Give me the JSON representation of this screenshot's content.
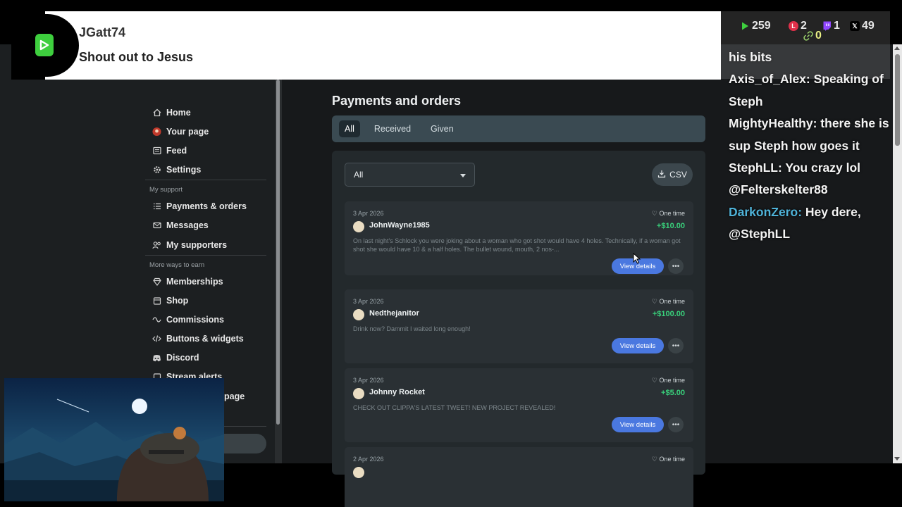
{
  "notification": {
    "username": "JGatt74",
    "message": "Shout out to Jesus"
  },
  "stats": {
    "rumble": "259",
    "lbry": "2",
    "twitch": "1",
    "x": "49",
    "links": "0"
  },
  "sidebar": {
    "items": [
      {
        "label": "Home",
        "icon": "home-icon"
      },
      {
        "label": "Your page",
        "icon": "avatar-icon"
      },
      {
        "label": "Feed",
        "icon": "feed-icon"
      },
      {
        "label": "Settings",
        "icon": "gear-icon"
      }
    ],
    "section_support": "My support",
    "support_items": [
      {
        "label": "Payments & orders",
        "icon": "list-icon"
      },
      {
        "label": "Messages",
        "icon": "mail-icon"
      },
      {
        "label": "My supporters",
        "icon": "people-icon"
      }
    ],
    "section_earn": "More ways to earn",
    "earn_items": [
      {
        "label": "Memberships",
        "icon": "diamond-icon"
      },
      {
        "label": "Shop",
        "icon": "shop-icon"
      },
      {
        "label": "Commissions",
        "icon": "commission-icon"
      },
      {
        "label": "Buttons & widgets",
        "icon": "code-icon"
      },
      {
        "label": "Discord",
        "icon": "discord-icon"
      },
      {
        "label": "Stream alerts",
        "icon": "alert-icon"
      }
    ],
    "partial_page_label": "page"
  },
  "main": {
    "title": "Payments and orders",
    "tabs": [
      "All",
      "Received",
      "Given"
    ],
    "filter_value": "All",
    "csv_label": "CSV",
    "payments": [
      {
        "date": "3 Apr 2026",
        "type": "One time",
        "name": "JohnWayne1985",
        "amount": "+$10.00",
        "message": "On last night's Schlock you were joking about a woman who got shot would have 4 holes. Technically, if a woman got shot she would have 10 & a half holes. The bullet wound, mouth, 2 nos-...",
        "button": "View details"
      },
      {
        "date": "3 Apr 2026",
        "type": "One time",
        "name": "Nedthejanitor",
        "amount": "+$100.00",
        "message": "Drink now? Dammit I waited long enough!",
        "button": "View details"
      },
      {
        "date": "3 Apr 2026",
        "type": "One time",
        "name": "Johnny Rocket",
        "amount": "+$5.00",
        "message": "CHECK OUT CLIPPA'S LATEST TWEET! NEW PROJECT REVEALED!",
        "button": "View details"
      },
      {
        "date": "2 Apr 2026",
        "type": "One time",
        "name": "",
        "amount": "",
        "message": "",
        "button": ""
      }
    ]
  },
  "chat": [
    {
      "text": "his bits"
    },
    {
      "user": "Axis_of_Alex:",
      "text": " Speaking of Steph"
    },
    {
      "user": "MightyHealthy:",
      "text": " there she is sup Steph how goes it"
    },
    {
      "user": "StephLL:",
      "text": " You crazy lol @Felterskelter88"
    },
    {
      "user": "DarkonZero:",
      "text": " Hey dere, @StephLL",
      "alt": true
    }
  ],
  "colors": {
    "accent_blue": "#4a78e0",
    "amount_green": "#39d07b",
    "rumble_green": "#3ecf3e",
    "chat_alt_user": "#4fb3d9"
  }
}
